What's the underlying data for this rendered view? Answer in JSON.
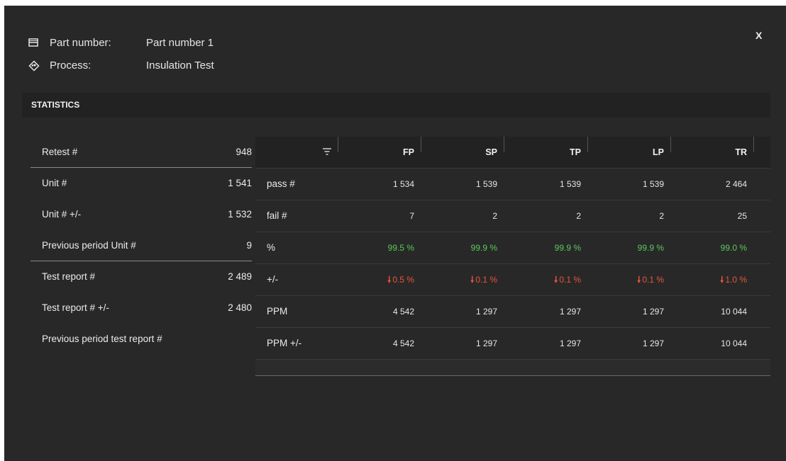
{
  "close_label": "X",
  "header": {
    "part_label": "Part number:",
    "part_value": "Part number 1",
    "process_label": "Process:",
    "process_value": "Insulation Test"
  },
  "section_title": "STATISTICS",
  "left_stats": [
    {
      "label": "Retest #",
      "value": "948"
    },
    {
      "label": "Unit #",
      "value": "1 541"
    },
    {
      "label": "Unit # +/-",
      "value": "1 532"
    },
    {
      "label": "Previous period Unit #",
      "value": "9"
    },
    {
      "label": "Test report #",
      "value": "2 489"
    },
    {
      "label": "Test report # +/-",
      "value": "2 480"
    },
    {
      "label": "Previous period test report #",
      "value": ""
    }
  ],
  "grid": {
    "columns": [
      "FP",
      "SP",
      "TP",
      "LP",
      "TR"
    ],
    "rows": [
      {
        "label": "pass #",
        "values": [
          "1 534",
          "1 539",
          "1 539",
          "1 539",
          "2 464"
        ]
      },
      {
        "label": "fail #",
        "values": [
          "7",
          "2",
          "2",
          "2",
          "25"
        ]
      },
      {
        "label": "%",
        "values": [
          "99.5 %",
          "99.9 %",
          "99.9 %",
          "99.9 %",
          "99.0 %"
        ]
      },
      {
        "label": "+/-",
        "values": [
          "0.5 %",
          "0.1 %",
          "0.1 %",
          "0.1 %",
          "1.0 %"
        ]
      },
      {
        "label": "PPM",
        "values": [
          "4 542",
          "1 297",
          "1 297",
          "1 297",
          "10 044"
        ]
      },
      {
        "label": "PPM +/-",
        "values": [
          "4 542",
          "1 297",
          "1 297",
          "1 297",
          "10 044"
        ]
      }
    ]
  },
  "colors": {
    "positive": "#5cc85c",
    "negative": "#e8563a",
    "background": "#282828"
  }
}
